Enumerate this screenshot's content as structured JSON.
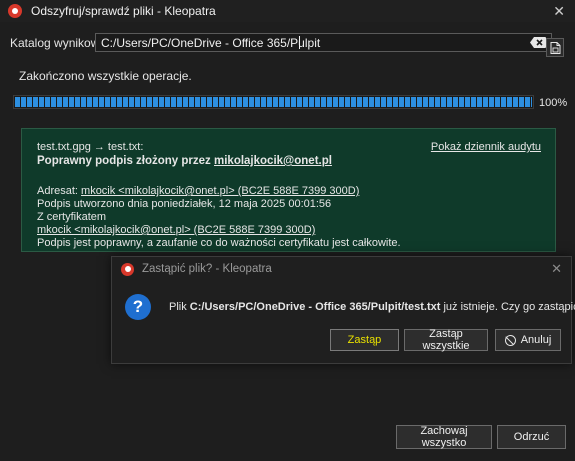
{
  "window": {
    "title": "Odszyfruj/sprawdź pliki - Kleopatra",
    "close_glyph": "✕"
  },
  "output": {
    "label": "Katalog wynikowy:",
    "value": "C:/Users/PC/OneDrive - Office 365/Pulpit",
    "clear_icon": "backspace-clear-icon",
    "browse_icon": "folder-file-icon"
  },
  "status": {
    "text": "Zakończono wszystkie operacje.",
    "progress_percent": 100,
    "progress_label": "100%"
  },
  "result": {
    "file_line": "test.txt.gpg → test.txt:",
    "valid_prefix": "Poprawny podpis złożony przez ",
    "valid_signer": "mikolajkocik@onet.pl",
    "audit_link": "Pokaż dziennik audytu",
    "addressee_label": "Adresat: ",
    "addressee_link": "mkocik <mikolajkocik@onet.pl> (BC2E 588E 7399 300D)",
    "created_line": "Podpis utworzono dnia poniedziałek, 12 maja 2025 00:01:56",
    "with_cert": "Z certyfikatem",
    "cert_link": "mkocik <mikolajkocik@onet.pl> (BC2E 588E 7399 300D)",
    "trust_line": "Podpis jest poprawny, a zaufanie co do ważności certyfikatu jest całkowite.",
    "background_color": "#0f3a2a"
  },
  "footer": {
    "keep_all": "Zachowaj wszystko",
    "reject": "Odrzuć"
  },
  "dialog": {
    "title": "Zastąpić plik? - Kleopatra",
    "close_glyph": "✕",
    "question_glyph": "?",
    "message_prefix": "Plik ",
    "message_path": "C:/Users/PC/OneDrive - Office 365/Pulpit/test.txt",
    "message_suffix": " już istnieje. Czy go zastąpić?",
    "replace": "Zastąp",
    "replace_all": "Zastąp wszystkie",
    "cancel": "Anuluj",
    "replace_text_color": "#e8e000"
  },
  "colors": {
    "accent_progress": "#2d8fe0",
    "app_icon_red": "#d8382b",
    "question_blue": "#1f6fd0"
  }
}
